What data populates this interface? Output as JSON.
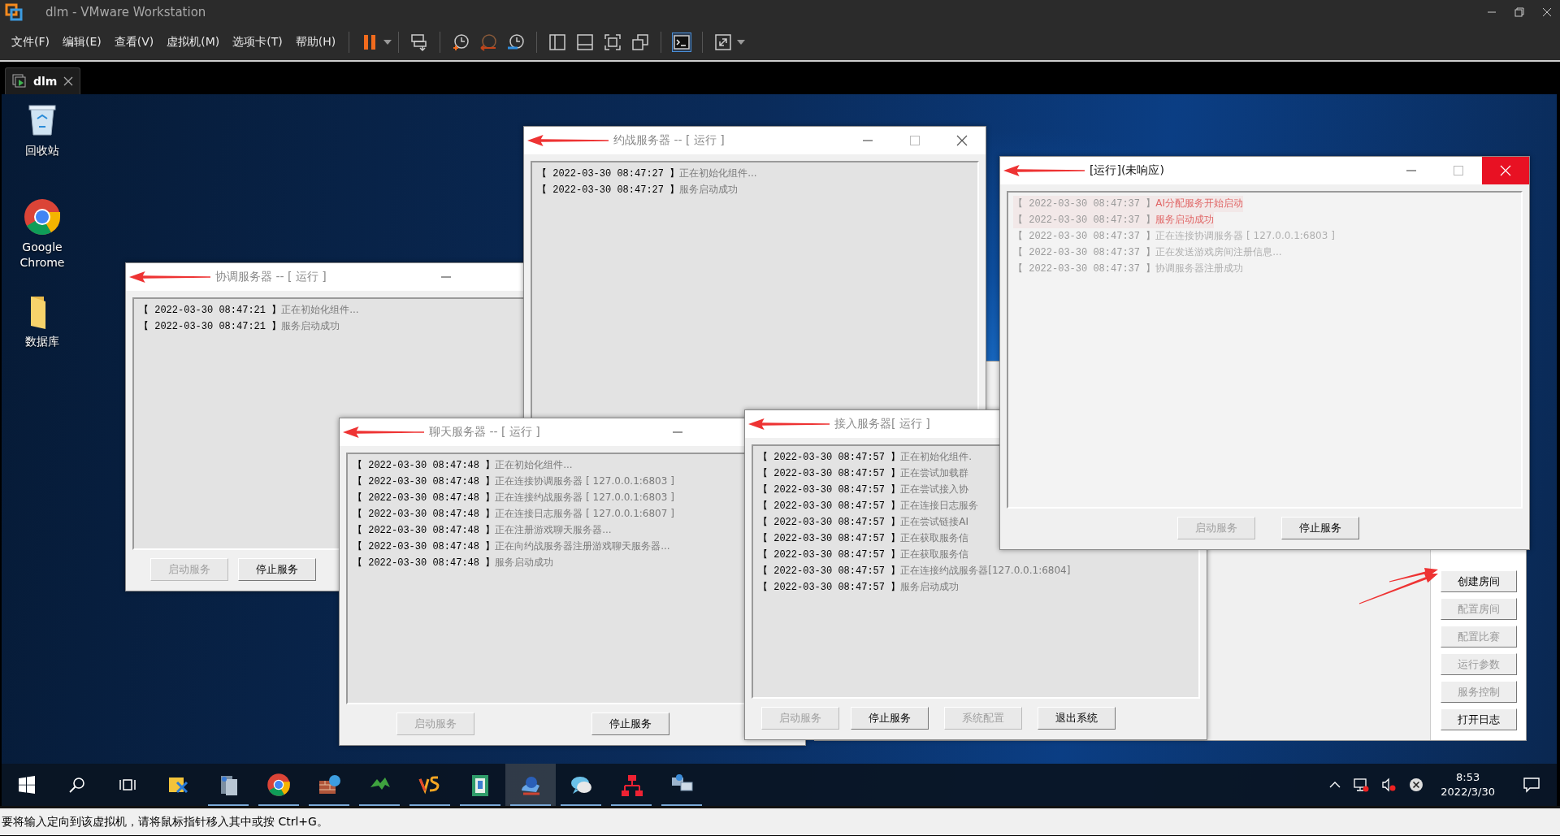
{
  "vmware": {
    "title": "dlm - VMware Workstation",
    "menus": [
      "文件(F)",
      "编辑(E)",
      "查看(V)",
      "虚拟机(M)",
      "选项卡(T)",
      "帮助(H)"
    ],
    "console_view": {
      "selected": true
    },
    "tab": {
      "label": "dlm",
      "selected": true
    }
  },
  "desktop_icons": [
    {
      "kind": "recycle",
      "label": "回收站"
    },
    {
      "kind": "chrome",
      "label": "Google Chrome"
    },
    {
      "kind": "folder",
      "label": "数据库"
    }
  ],
  "background_window": {
    "annotated": true,
    "buttons": [
      {
        "label": "创建房间",
        "disabled": false
      },
      {
        "label": "配置房间",
        "disabled": true
      },
      {
        "label": "配置比赛",
        "disabled": true
      },
      {
        "label": "运行参数",
        "disabled": true
      },
      {
        "label": "服务控制",
        "disabled": true
      },
      {
        "label": "打开日志",
        "disabled": false
      }
    ]
  },
  "windows": [
    {
      "title": "协调服务器 -- [ 运行 ]",
      "active": false,
      "faded": false,
      "annotated": true,
      "log": [
        {
          "time": "【 2022-03-30 08:47:21 】",
          "message": "正在初始化组件...",
          "highlighted": false
        },
        {
          "time": "【 2022-03-30 08:47:21 】",
          "message": "服务启动成功",
          "highlighted": false
        }
      ],
      "buttons": [
        {
          "label": "启动服务",
          "disabled": true
        },
        {
          "label": "停止服务",
          "disabled": false
        }
      ]
    },
    {
      "title": "约战服务器 -- [ 运行 ]",
      "active": false,
      "faded": false,
      "annotated": true,
      "log": [
        {
          "time": "【 2022-03-30 08:47:27 】",
          "message": "正在初始化组件...",
          "highlighted": false
        },
        {
          "time": "【 2022-03-30 08:47:27 】",
          "message": "服务启动成功",
          "highlighted": false
        }
      ]
    },
    {
      "title": "聊天服务器 -- [ 运行 ]",
      "active": false,
      "faded": false,
      "annotated": true,
      "log": [
        {
          "time": "【 2022-03-30 08:47:48 】",
          "message": "正在初始化组件...",
          "highlighted": false
        },
        {
          "time": "【 2022-03-30 08:47:48 】",
          "message": "正在连接协调服务器 [ 127.0.0.1:6803 ]",
          "highlighted": false
        },
        {
          "time": "【 2022-03-30 08:47:48 】",
          "message": "正在连接约战服务器 [ 127.0.0.1:6803 ]",
          "highlighted": false
        },
        {
          "time": "【 2022-03-30 08:47:48 】",
          "message": "正在连接日志服务器 [ 127.0.0.1:6807 ]",
          "highlighted": false
        },
        {
          "time": "【 2022-03-30 08:47:48 】",
          "message": "正在注册游戏聊天服务器...",
          "highlighted": false
        },
        {
          "time": "【 2022-03-30 08:47:48 】",
          "message": "正在向约战服务器注册游戏聊天服务器...",
          "highlighted": false
        },
        {
          "time": "【 2022-03-30 08:47:48 】",
          "message": "服务启动成功",
          "highlighted": false
        }
      ],
      "buttons": [
        {
          "label": "启动服务",
          "disabled": true
        },
        {
          "label": "停止服务",
          "disabled": false
        }
      ]
    },
    {
      "title": "接入服务器[ 运行 ]",
      "active": false,
      "faded": false,
      "annotated": true,
      "log": [
        {
          "time": "【 2022-03-30 08:47:57 】",
          "message": "正在初始化组件.",
          "highlighted": false
        },
        {
          "time": "【 2022-03-30 08:47:57 】",
          "message": "正在尝试加载群",
          "highlighted": false
        },
        {
          "time": "【 2022-03-30 08:47:57 】",
          "message": "正在尝试接入协",
          "highlighted": false
        },
        {
          "time": "【 2022-03-30 08:47:57 】",
          "message": "正在连接日志服务",
          "highlighted": false
        },
        {
          "time": "【 2022-03-30 08:47:57 】",
          "message": "正在尝试链接AI",
          "highlighted": false
        },
        {
          "time": "【 2022-03-30 08:47:57 】",
          "message": "正在获取服务信",
          "highlighted": false
        },
        {
          "time": "【 2022-03-30 08:47:57 】",
          "message": "正在获取服务信",
          "highlighted": false
        },
        {
          "time": "【 2022-03-30 08:47:57 】",
          "message": "正在连接约战服务器[127.0.0.1:6804]",
          "highlighted": false
        },
        {
          "time": "【 2022-03-30 08:47:57 】",
          "message": "服务启动成功",
          "highlighted": false
        }
      ],
      "buttons": [
        {
          "label": "启动服务",
          "disabled": true
        },
        {
          "label": "停止服务",
          "disabled": false
        },
        {
          "label": "系统配置",
          "disabled": true
        },
        {
          "label": "退出系统",
          "disabled": false
        }
      ]
    },
    {
      "title": "[运行](未响应)",
      "active": true,
      "faded": true,
      "annotated": true,
      "log": [
        {
          "time": "【 2022-03-30 08:47:37 】",
          "message": "AI分配服务开始启动",
          "highlighted": true
        },
        {
          "time": "【 2022-03-30 08:47:37 】",
          "message": "服务启动成功",
          "highlighted": true
        },
        {
          "time": "【 2022-03-30 08:47:37 】",
          "message": "正在连接协调服务器 [ 127.0.0.1:6803 ]",
          "highlighted": false
        },
        {
          "time": "【 2022-03-30 08:47:37 】",
          "message": "正在发送游戏房间注册信息...",
          "highlighted": false
        },
        {
          "time": "【 2022-03-30 08:47:37 】",
          "message": "协调服务器注册成功",
          "highlighted": false
        }
      ],
      "buttons": [
        {
          "label": "启动服务",
          "disabled": true
        },
        {
          "label": "停止服务",
          "disabled": false
        }
      ]
    }
  ],
  "taskbar": {
    "apps": [
      {
        "kind": "tools",
        "running": false,
        "selected": false
      },
      {
        "kind": "server",
        "running": true,
        "selected": false
      },
      {
        "kind": "chrome",
        "running": true,
        "selected": false
      },
      {
        "kind": "globe",
        "running": true,
        "selected": false
      },
      {
        "kind": "arrows",
        "running": true,
        "selected": false
      },
      {
        "kind": "vs",
        "running": true,
        "selected": false
      },
      {
        "kind": "book",
        "running": true,
        "selected": false
      },
      {
        "kind": "gear",
        "running": true,
        "selected": true
      },
      {
        "kind": "chat",
        "running": true,
        "selected": false
      },
      {
        "kind": "network",
        "running": true,
        "selected": false
      },
      {
        "kind": "computers",
        "running": true,
        "selected": false
      }
    ],
    "time": "8:53",
    "date": "2022/3/30"
  },
  "status_bar": "要将输入定向到该虚拟机，请将鼠标指针移入其中或按 Ctrl+G。"
}
